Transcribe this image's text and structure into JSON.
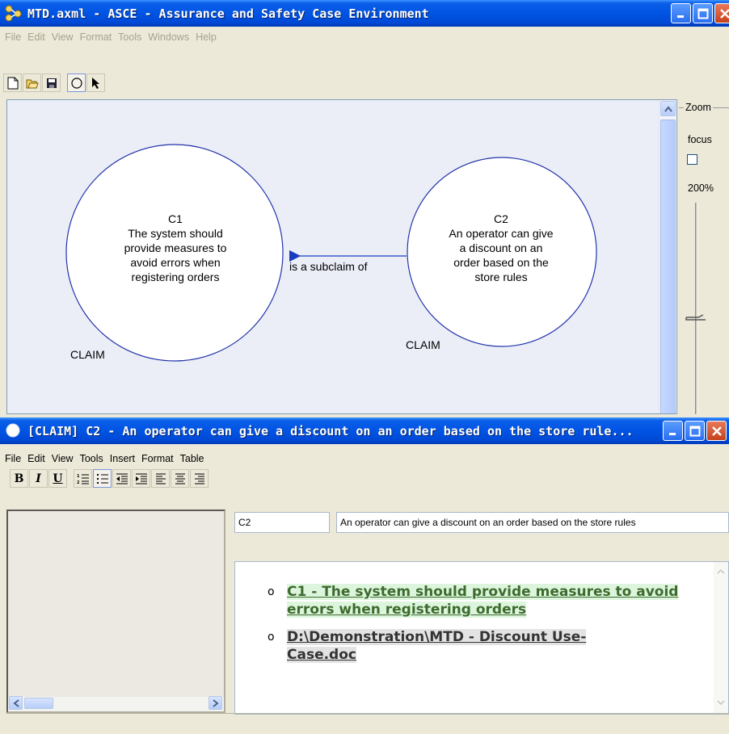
{
  "main_window": {
    "title": "MTD.axml - ASCE - Assurance and Safety Case Environment",
    "menu": [
      "File",
      "Edit",
      "View",
      "Format",
      "Tools",
      "Windows",
      "Help"
    ],
    "toolbar_icons": [
      "new-file-icon",
      "open-folder-icon",
      "save-icon",
      "ellipse-tool-icon",
      "pointer-tool-icon"
    ]
  },
  "diagram": {
    "nodes": [
      {
        "id": "C1",
        "text": [
          "The system should",
          "provide measures to",
          "avoid errors when",
          "registering orders"
        ],
        "type_label": "CLAIM"
      },
      {
        "id": "C2",
        "text": [
          "An operator can give",
          "a discount on an",
          "order based on the",
          "store rules"
        ],
        "type_label": "CLAIM"
      }
    ],
    "link_label": "is a subclaim of"
  },
  "zoom": {
    "legend": "Zoom",
    "focus_label": "focus",
    "focus_checked": false,
    "level": "200%"
  },
  "editor_window": {
    "title": "[CLAIM] C2 - An operator can give a discount on an order based on the store rule...",
    "menu": [
      "File",
      "Edit",
      "View",
      "Tools",
      "Insert",
      "Format",
      "Table"
    ],
    "format_buttons": [
      "B",
      "I",
      "U"
    ],
    "format_icons": [
      "numbered-list-icon",
      "bullet-list-icon",
      "decrease-indent-icon",
      "increase-indent-icon",
      "align-left-icon",
      "align-center-icon",
      "align-right-icon"
    ],
    "id_field": "C2",
    "description_field": "An operator can give a discount on an order based on the store rules",
    "links": [
      {
        "text": "C1 - The system should provide measures to avoid errors when registering orders"
      },
      {
        "text": "D:\\Demonstration\\MTD - Discount Use-Case.doc"
      }
    ]
  },
  "colors": {
    "titlebar": "#0054e3",
    "canvas": "#ebeef7",
    "node_stroke": "#2233aa",
    "arrow": "#1a3bbf",
    "link_green_bg": "#ddf5dd"
  }
}
